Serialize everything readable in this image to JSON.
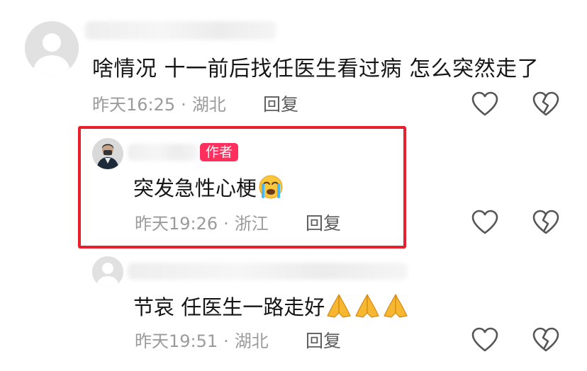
{
  "comments": [
    {
      "text": "啥情况 十一前后找任医生看过病 怎么突然走了",
      "time": "昨天16:25",
      "location": "湖北",
      "reply_label": "回复"
    }
  ],
  "replies": [
    {
      "badge": "作者",
      "text": "突发急性心梗",
      "emoji": "loudly-crying-face",
      "time": "昨天19:26",
      "location": "浙江",
      "reply_label": "回复"
    },
    {
      "text": "节哀 任医生一路走好",
      "emoji": "folded-hands x3",
      "time": "昨天19:51",
      "location": "湖北",
      "reply_label": "回复"
    }
  ],
  "meta_separator": "·",
  "colors": {
    "highlight": "#e8202b",
    "badge": "#ff2f5e",
    "meta": "#9b9b9b",
    "icon": "#555555"
  },
  "icons": [
    "heart-icon",
    "broken-heart-icon"
  ]
}
